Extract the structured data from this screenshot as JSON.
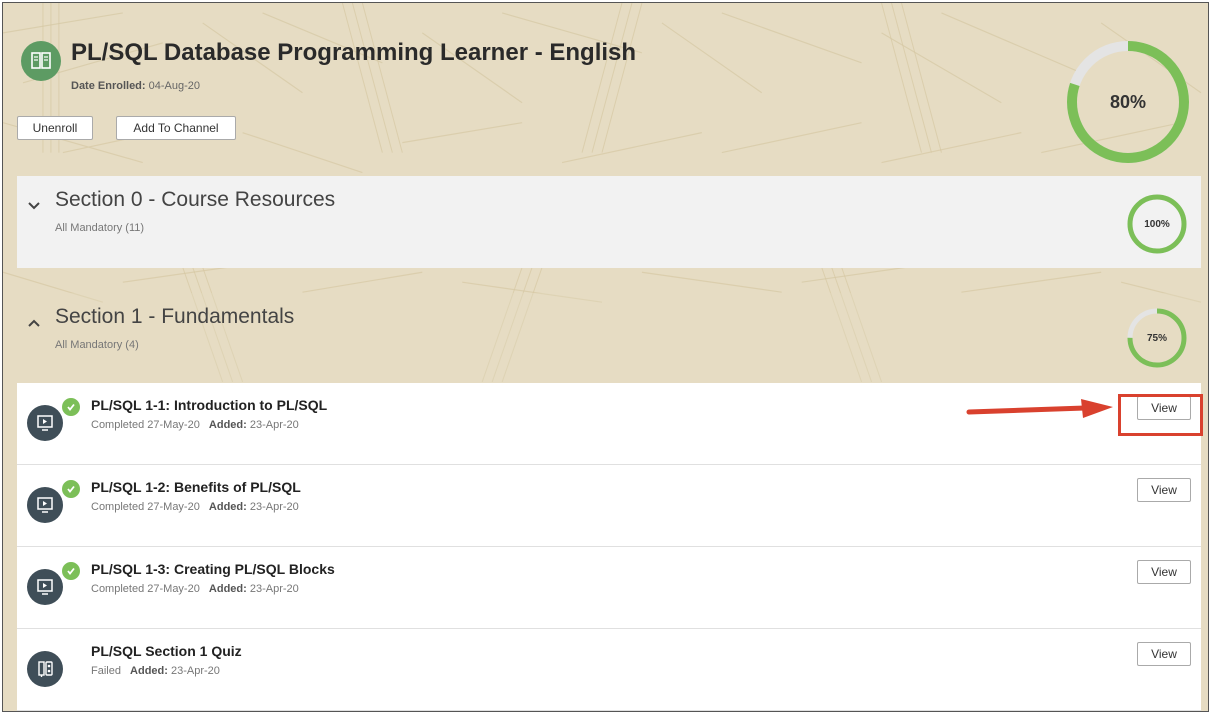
{
  "course": {
    "title": "PL/SQL Database Programming Learner - English",
    "enrolled_label": "Date Enrolled:",
    "enrolled_date": "04-Aug-20",
    "progress_label": "80%",
    "progress": 0.8,
    "icon": "book-icon",
    "unenroll_label": "Unenroll",
    "add_channel_label": "Add To Channel"
  },
  "sections": [
    {
      "title": "Section 0 - Course Resources",
      "subtitle": "All Mandatory (11)",
      "progress_label": "100%",
      "progress": 1.0,
      "expanded": false
    },
    {
      "title": "Section 1 - Fundamentals",
      "subtitle": "All Mandatory (4)",
      "progress_label": "75%",
      "progress": 0.75,
      "expanded": true
    }
  ],
  "items": [
    {
      "title": "PL/SQL 1-1: Introduction to PL/SQL",
      "status": "Completed 27-May-20",
      "added_label": "Added:",
      "added": "23-Apr-20",
      "view_label": "View",
      "icon": "video-monitor-icon",
      "completed": true
    },
    {
      "title": "PL/SQL 1-2: Benefits of PL/SQL",
      "status": "Completed 27-May-20",
      "added_label": "Added:",
      "added": "23-Apr-20",
      "view_label": "View",
      "icon": "video-monitor-icon",
      "completed": true
    },
    {
      "title": "PL/SQL 1-3: Creating PL/SQL Blocks",
      "status": "Completed 27-May-20",
      "added_label": "Added:",
      "added": "23-Apr-20",
      "view_label": "View",
      "icon": "video-monitor-icon",
      "completed": true
    },
    {
      "title": "PL/SQL Section 1 Quiz",
      "status": "Failed",
      "added_label": "Added:",
      "added": "23-Apr-20",
      "view_label": "View",
      "icon": "quiz-icon",
      "completed": false
    }
  ],
  "colors": {
    "ring_green": "#7cbf58",
    "ring_track": "#e4e4e4",
    "highlight_red": "#d9412e",
    "background": "#e6dcc3"
  }
}
